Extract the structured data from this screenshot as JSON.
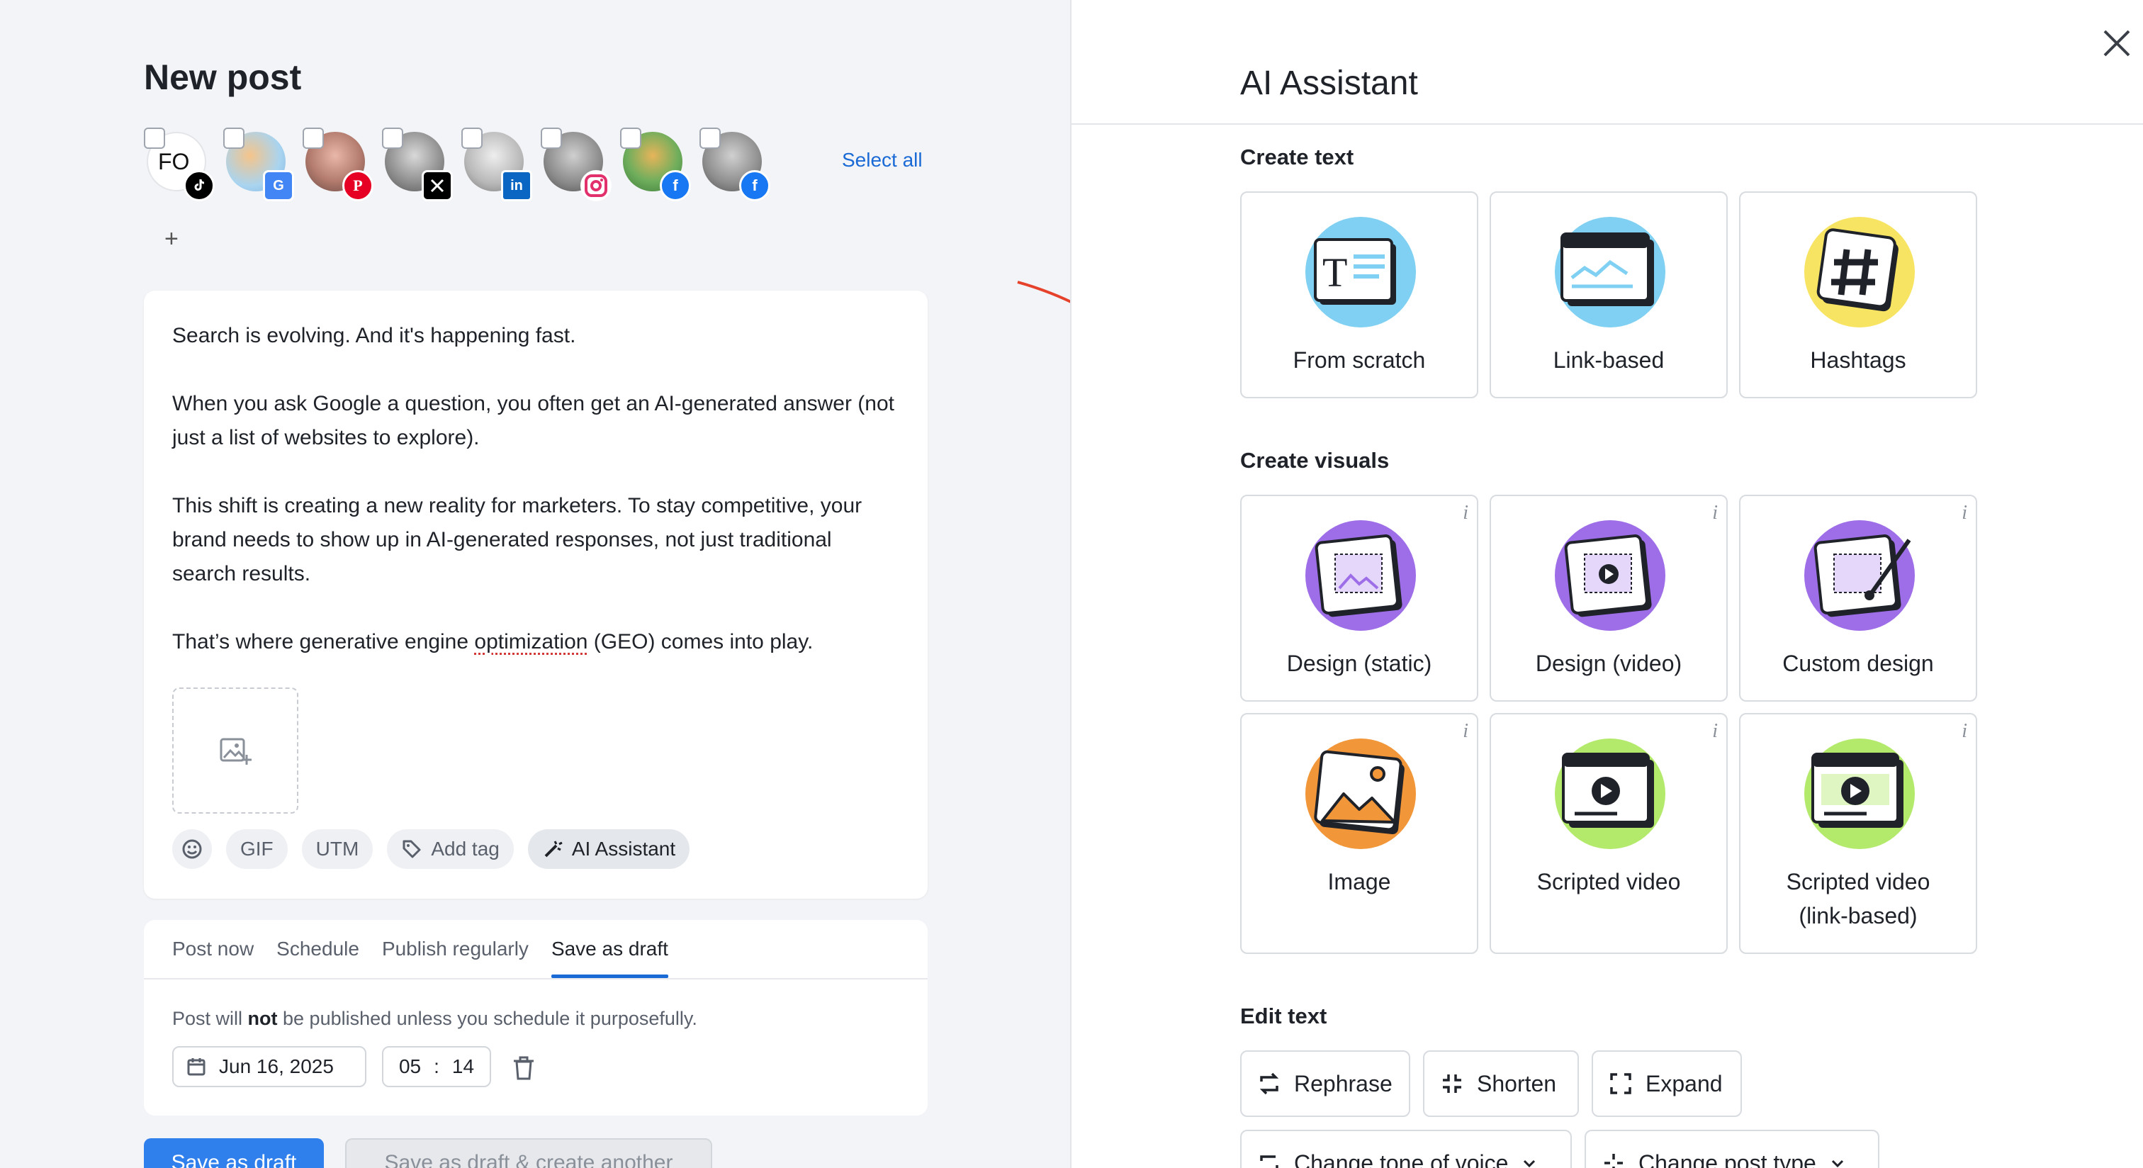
{
  "composer": {
    "title": "New post",
    "select_all": "Select all",
    "add_account": "+",
    "accounts": [
      {
        "id": "tiktok",
        "initials": "FO",
        "network": "tiktok",
        "network_color": "#000000"
      },
      {
        "id": "gbp",
        "initials": "",
        "network": "google-business",
        "network_color": "#4285f4"
      },
      {
        "id": "pinterest",
        "initials": "",
        "network": "pinterest",
        "network_color": "#e60023"
      },
      {
        "id": "x",
        "initials": "",
        "network": "x",
        "network_color": "#000000"
      },
      {
        "id": "linkedin",
        "initials": "",
        "network": "linkedin",
        "network_color": "#0a66c2"
      },
      {
        "id": "instagram",
        "initials": "",
        "network": "instagram",
        "network_color": "#e1306c"
      },
      {
        "id": "facebook1",
        "initials": "",
        "network": "facebook",
        "network_color": "#1877f2"
      },
      {
        "id": "facebook2",
        "initials": "",
        "network": "facebook",
        "network_color": "#1877f2"
      }
    ],
    "post": {
      "p1": "Search is evolving. And it's happening fast.",
      "p2": "When you ask Google a question, you often get an AI-generated answer (not just a list of websites to explore).",
      "p3": "This shift is creating a new reality for marketers. To stay competitive, your brand needs to show up in AI-generated responses, not just traditional search results.",
      "p4_before": "That’s where generative engine ",
      "p4_misspelled": "optimization",
      "p4_after": " (GEO) comes into play."
    },
    "toolbar": {
      "emoji_icon": "smile-icon",
      "gif": "GIF",
      "utm": "UTM",
      "add_tag": "Add tag",
      "ai_assistant": "AI Assistant"
    },
    "publish": {
      "tabs": [
        "Post now",
        "Schedule",
        "Publish regularly",
        "Save as draft"
      ],
      "active_tab": 3,
      "note_before": "Post will ",
      "note_bold": "not",
      "note_after": " be published unless you schedule it purposefully.",
      "date": "Jun 16, 2025",
      "hour": "05",
      "sep": ":",
      "minute": "14"
    },
    "buttons": {
      "save_draft": "Save as draft",
      "save_draft_another": "Save as draft & create another"
    }
  },
  "assistant": {
    "title": "AI Assistant",
    "create_text": {
      "heading": "Create text",
      "cards": [
        "From scratch",
        "Link-based",
        "Hashtags"
      ]
    },
    "create_visuals": {
      "heading": "Create visuals",
      "cards": [
        "Design (static)",
        "Design (video)",
        "Custom design",
        "Image",
        "Scripted video",
        "Scripted video",
        "(link-based)"
      ],
      "info": "i"
    },
    "edit_text": {
      "heading": "Edit text",
      "buttons": [
        "Rephrase",
        "Shorten",
        "Expand",
        "Change tone of voice",
        "Change post type"
      ]
    }
  },
  "colors": {
    "accent": "#1a6ad6",
    "primary_button": "#2f80ed",
    "annotation_arrow": "#e5412b",
    "text_card_blob": "#7fd0f2",
    "hashtag_blob": "#f7e463",
    "visual_blob": "#9e6ee8",
    "image_blob": "#f2963a",
    "video_blob": "#b4ea6c"
  }
}
